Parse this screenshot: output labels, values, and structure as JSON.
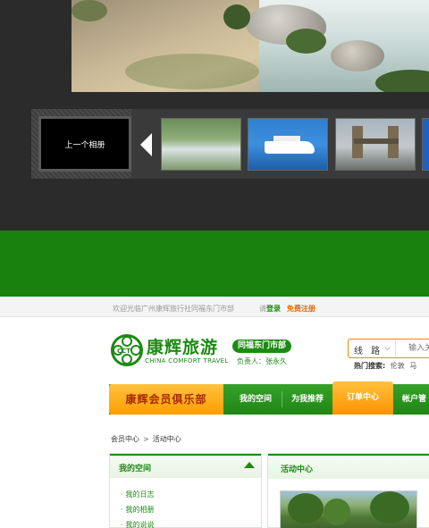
{
  "album": {
    "prev_album_label": "上一个相册",
    "thumbnails": [
      "waterfall-forest",
      "cruise-ship",
      "tower-bridge",
      "blue-partial"
    ]
  },
  "topbar": {
    "welcome": "欢迎光临广州康辉旅行社同福东门市部",
    "please": "请",
    "login": "登录",
    "register": "免费注册"
  },
  "logo": {
    "mark": "CCT",
    "cn": "康辉旅游",
    "en": "CHINA COMFORT TRAVEL",
    "branch": "同福东门市部",
    "manager": "负责人：张永久"
  },
  "search": {
    "type": "线 路",
    "placeholder": "输入关",
    "hot_label": "热门搜索:",
    "hot_words": [
      "伦敦",
      "马"
    ]
  },
  "nav": {
    "club": "康辉会员俱乐部",
    "items": [
      "我的空间",
      "为我推荐",
      "订单中心",
      "帐户管"
    ]
  },
  "breadcrumb": [
    "会员中心",
    "活动中心"
  ],
  "left_panel": {
    "title": "我的空间",
    "links": [
      "我的日志",
      "我的相册",
      "我的说说"
    ]
  },
  "right_panel": {
    "title": "活动中心"
  },
  "colors": {
    "brand_green": "#1c8a14",
    "band_green": "#19820f",
    "accent_orange": "#ff9d00",
    "viewer_bg": "#2b2b2b"
  }
}
